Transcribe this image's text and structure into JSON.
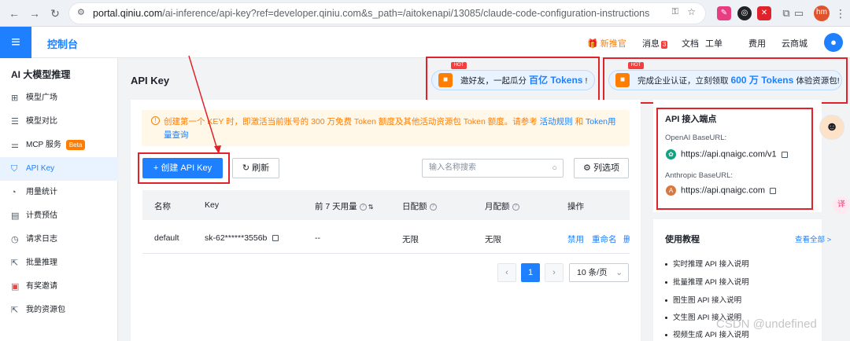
{
  "browser": {
    "url_host": "portal.qiniu.com",
    "url_path": "/ai-inference/api-key?ref=developer.qiniu.com&s_path=/aitokenapi/13085/claude-code-configuration-instructions",
    "profile_initials": "hm"
  },
  "topbar": {
    "console_title": "控制台",
    "new_user": "新推官",
    "messages": "消息",
    "message_count": "3",
    "docs": "文档",
    "tickets": "工单",
    "billing": "费用",
    "cloud_mall": "云商城"
  },
  "sidebar": {
    "title": "AI 大模型推理",
    "items": [
      {
        "label": "模型广场",
        "icon": "grid-icon"
      },
      {
        "label": "模型对比",
        "icon": "compare-icon"
      },
      {
        "label": "MCP 服务",
        "icon": "sliders-icon",
        "badge": "Beta"
      },
      {
        "label": "API Key",
        "icon": "shield-icon"
      },
      {
        "label": "用量统计",
        "icon": "pie-chart-icon"
      },
      {
        "label": "计费预估",
        "icon": "document-icon"
      },
      {
        "label": "请求日志",
        "icon": "clock-icon"
      },
      {
        "label": "批量推理",
        "icon": "external-icon"
      },
      {
        "label": "有奖邀请",
        "icon": "gift-icon"
      },
      {
        "label": "我的资源包",
        "icon": "external-icon"
      }
    ],
    "active_index": 3
  },
  "page": {
    "title": "API Key"
  },
  "promos": [
    {
      "badge": "HOT",
      "prefix": "邀好友，一起瓜分",
      "highlight": "百亿 Tokens",
      "suffix": "!"
    },
    {
      "badge": "HOT",
      "prefix": "完成企业认证，立刻领取",
      "highlight": "600 万 Tokens",
      "suffix": "体验资源包!"
    }
  ],
  "notice": {
    "text": "创建第一个 KEY 时，即激活当前账号的 300 万免费 Token 额度及其他活动资源包 Token 额度。请参考",
    "link1": "活动规则",
    "and": "和",
    "link2": "Token用量查询"
  },
  "toolbar": {
    "create_label": "+ 创建 API Key",
    "refresh_label": "刷新",
    "search_placeholder": "输入名称搜索",
    "columns_label": "列选项"
  },
  "table": {
    "headers": [
      "名称",
      "Key",
      "前 7 天用量",
      "日配额",
      "月配额",
      "操作"
    ],
    "rows": [
      {
        "name": "default",
        "key": "sk-62******3556b",
        "usage7d": "--",
        "daily": "无限",
        "monthly": "无限",
        "actions": [
          "禁用",
          "重命名",
          "删"
        ]
      }
    ]
  },
  "pagination": {
    "current": "1",
    "page_size": "10 条/页"
  },
  "endpoints": {
    "title": "API 接入端点",
    "openai_label": "OpenAI BaseURL:",
    "openai_url": "https://api.qnaigc.com/v1",
    "anthropic_label": "Anthropic BaseURL:",
    "anthropic_url": "https://api.qnaigc.com"
  },
  "tutorials": {
    "title": "使用教程",
    "view_all": "查看全部 >",
    "items": [
      "实时推理 API 接入说明",
      "批量推理 API 接入说明",
      "图生图 API 接入说明",
      "文生图 API 接入说明",
      "视频生成 API 接入说明"
    ]
  },
  "watermark": "CSDN @undefined",
  "colors": {
    "primary": "#1e80ff",
    "highlight_border": "#e0232b",
    "notice_text": "#ff7d00",
    "notice_bg": "#fff7e8"
  }
}
